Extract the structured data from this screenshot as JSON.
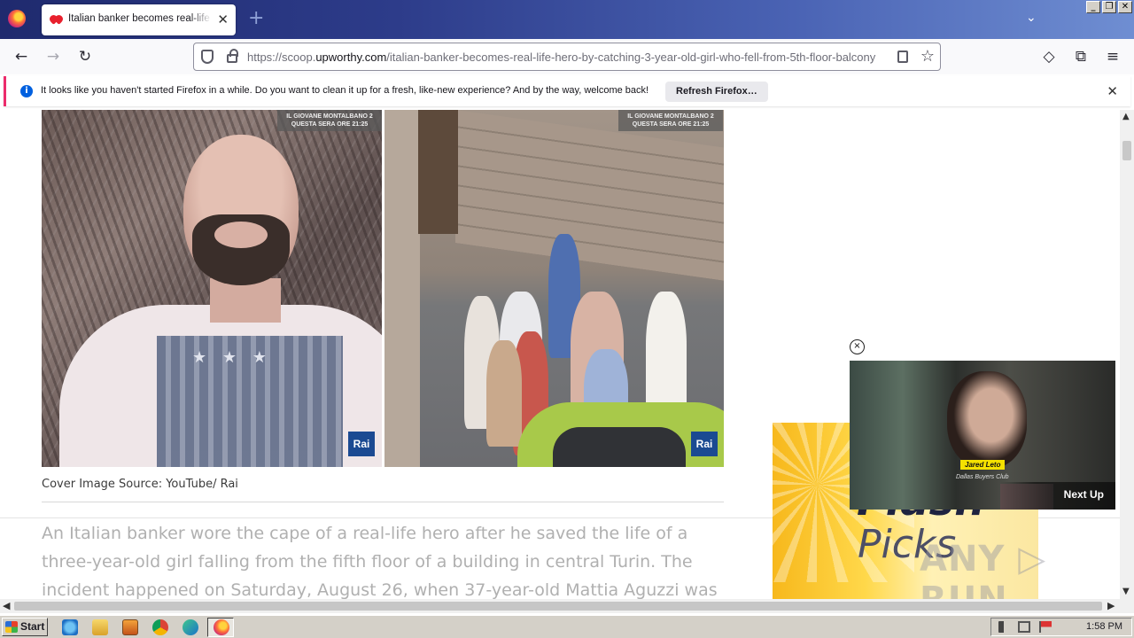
{
  "browser": {
    "tab": {
      "title": "Italian banker becomes real-life hero",
      "close_glyph": "✕"
    },
    "new_tab_glyph": "+",
    "tab_list_glyph": "⌄",
    "window_buttons": [
      "_",
      "❐",
      "✕"
    ],
    "nav": {
      "back_glyph": "←",
      "forward_glyph": "→",
      "reload_glyph": "↻"
    },
    "url": {
      "prefix": "https://scoop.",
      "domain": "upworthy.com",
      "path": "/italian-banker-becomes-real-life-hero-by-catching-3-year-old-girl-who-fell-from-5th-floor-balcony"
    },
    "toolbar_glyphs": {
      "bookmark_star": "☆",
      "pocket": "◇",
      "extensions": "⧉",
      "menu": "≡"
    }
  },
  "notification": {
    "icon": "info-icon",
    "icon_glyph": "i",
    "text": "It looks like you haven't started Firefox in a while. Do you want to clean it up for a fresh, like-new experience? And by the way, welcome back!",
    "button_label": "Refresh Firefox…",
    "close_glyph": "✕"
  },
  "article": {
    "tv_label_line1": "IL GIOVANE MONTALBANO 2",
    "tv_label_line2": "QUESTA SERA ORE 21:25",
    "rai_logo": "Rai",
    "caption": "Cover Image Source: YouTube/ Rai",
    "body": "An Italian banker wore the cape of a real-life hero after he saved the life of a three-year-old girl falling from the fifth floor of a building in central Turin. The incident happened on Saturday, August 26, when 37-year-old Mattia Aguzzi was on his way"
  },
  "ad": {
    "line1": "Flash",
    "line2": "Picks"
  },
  "video": {
    "close_glyph": "×",
    "name_badge": "Jared Leto",
    "subtitle": "Dallas Buyers Club",
    "next_up_label": "Next Up"
  },
  "watermark": "ANY ▷ RUN",
  "scrollbars": {
    "up": "▲",
    "down": "▼",
    "left": "◀",
    "right": "▶"
  },
  "taskbar": {
    "start_label": "Start",
    "clock": "1:58 PM",
    "pinned": [
      "internet-explorer-icon",
      "file-explorer-icon",
      "media-player-icon",
      "chrome-icon",
      "edge-icon",
      "firefox-icon"
    ]
  },
  "colors": {
    "accent_pink": "#ec2c6c",
    "info_blue": "#0060df",
    "tab_gradient_start": "#1f2a6e",
    "ad_yellow": "#f7b81c"
  }
}
